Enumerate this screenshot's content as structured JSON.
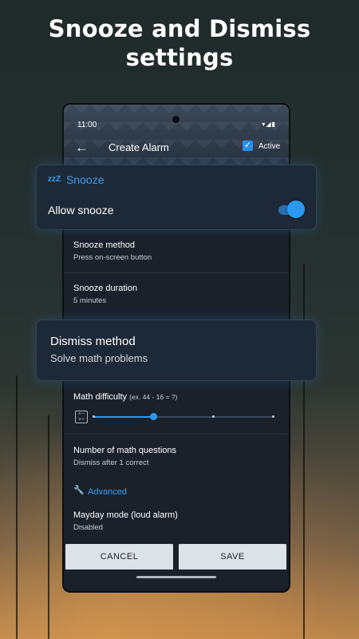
{
  "headline": "Snooze and Dismiss settings",
  "status": {
    "time": "11:00",
    "icons": "▾◢▮"
  },
  "appbar": {
    "title": "Create Alarm",
    "active_label": "Active",
    "active_checked": true
  },
  "snooze_card": {
    "icon_text": "zzZ",
    "title": "Snooze",
    "allow_label": "Allow snooze",
    "allow_on": true
  },
  "snooze_method": {
    "title": "Snooze method",
    "value": "Press on-screen button"
  },
  "snooze_duration": {
    "title": "Snooze duration",
    "value": "5 minutes"
  },
  "dismiss_card": {
    "title": "Dismiss method",
    "value": "Solve math problems"
  },
  "math_difficulty": {
    "title": "Math difficulty",
    "hint": "(ex. 44 - 16 = ?)",
    "level": 2,
    "levels": 5
  },
  "math_questions": {
    "title": "Number of math questions",
    "value": "Dismiss after 1 correct"
  },
  "advanced": {
    "label": "Advanced"
  },
  "mayday": {
    "title": "Mayday mode (loud alarm)",
    "value": "Disabled"
  },
  "buttons": {
    "cancel": "CANCEL",
    "save": "SAVE"
  },
  "colors": {
    "accent": "#2a99f2",
    "surface": "#1a212b"
  }
}
